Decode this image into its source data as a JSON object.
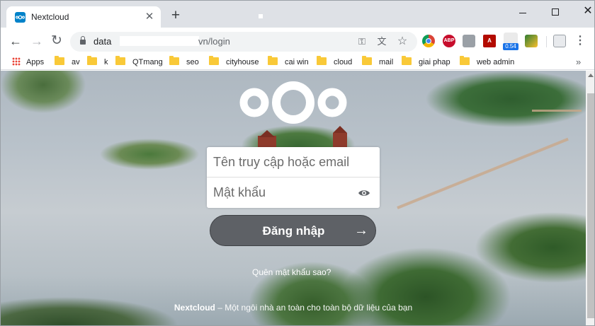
{
  "browser": {
    "tab": {
      "title": "Nextcloud",
      "close_glyph": "✕",
      "favicon": "nextcloud-logo-icon"
    },
    "new_tab_glyph": "+",
    "window_controls": {
      "close_glyph": "✕"
    },
    "toolbar": {
      "back_glyph": "←",
      "forward_glyph": "→",
      "reload_glyph": "↻",
      "url_host": "data",
      "url_path": "vn/login",
      "key_glyph": "⚿",
      "translate_glyph": "文",
      "star_glyph": "☆",
      "menu_glyph": "⋮"
    },
    "extensions": {
      "abp_label": "ABP",
      "pdf_label": "A",
      "speed_badge": "0.54"
    },
    "bookmarks": {
      "apps_label": "Apps",
      "items": [
        "av",
        "k",
        "QTmang",
        "seo",
        "cityhouse",
        "cai win",
        "cloud",
        "mail",
        "giai phap",
        "web admin"
      ],
      "more_glyph": "»"
    }
  },
  "login": {
    "username_placeholder": "Tên truy cập hoặc email",
    "password_placeholder": "Mật khẩu",
    "button_label": "Đăng nhập",
    "button_arrow": "→",
    "forgot_password": "Quên mật khẩu sao?"
  },
  "footer": {
    "brand": "Nextcloud",
    "tagline": " – Một ngôi nhà an toàn cho toàn bộ dữ liệu của bạn"
  },
  "colors": {
    "brand_blue": "#0082c9",
    "button_bg": "#5e6166",
    "tab_strip": "#dee1e6"
  }
}
